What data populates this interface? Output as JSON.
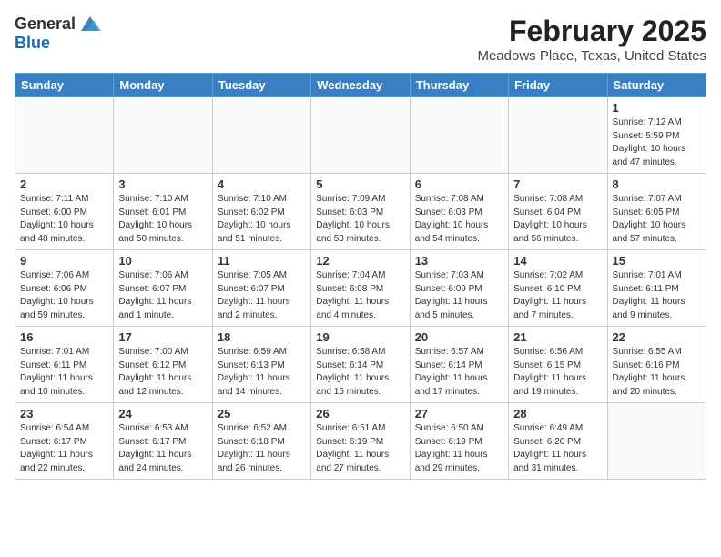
{
  "header": {
    "logo_general": "General",
    "logo_blue": "Blue",
    "month": "February 2025",
    "location": "Meadows Place, Texas, United States"
  },
  "days_of_week": [
    "Sunday",
    "Monday",
    "Tuesday",
    "Wednesday",
    "Thursday",
    "Friday",
    "Saturday"
  ],
  "weeks": [
    [
      {
        "day": "",
        "info": ""
      },
      {
        "day": "",
        "info": ""
      },
      {
        "day": "",
        "info": ""
      },
      {
        "day": "",
        "info": ""
      },
      {
        "day": "",
        "info": ""
      },
      {
        "day": "",
        "info": ""
      },
      {
        "day": "1",
        "info": "Sunrise: 7:12 AM\nSunset: 5:59 PM\nDaylight: 10 hours and 47 minutes."
      }
    ],
    [
      {
        "day": "2",
        "info": "Sunrise: 7:11 AM\nSunset: 6:00 PM\nDaylight: 10 hours and 48 minutes."
      },
      {
        "day": "3",
        "info": "Sunrise: 7:10 AM\nSunset: 6:01 PM\nDaylight: 10 hours and 50 minutes."
      },
      {
        "day": "4",
        "info": "Sunrise: 7:10 AM\nSunset: 6:02 PM\nDaylight: 10 hours and 51 minutes."
      },
      {
        "day": "5",
        "info": "Sunrise: 7:09 AM\nSunset: 6:03 PM\nDaylight: 10 hours and 53 minutes."
      },
      {
        "day": "6",
        "info": "Sunrise: 7:08 AM\nSunset: 6:03 PM\nDaylight: 10 hours and 54 minutes."
      },
      {
        "day": "7",
        "info": "Sunrise: 7:08 AM\nSunset: 6:04 PM\nDaylight: 10 hours and 56 minutes."
      },
      {
        "day": "8",
        "info": "Sunrise: 7:07 AM\nSunset: 6:05 PM\nDaylight: 10 hours and 57 minutes."
      }
    ],
    [
      {
        "day": "9",
        "info": "Sunrise: 7:06 AM\nSunset: 6:06 PM\nDaylight: 10 hours and 59 minutes."
      },
      {
        "day": "10",
        "info": "Sunrise: 7:06 AM\nSunset: 6:07 PM\nDaylight: 11 hours and 1 minute."
      },
      {
        "day": "11",
        "info": "Sunrise: 7:05 AM\nSunset: 6:07 PM\nDaylight: 11 hours and 2 minutes."
      },
      {
        "day": "12",
        "info": "Sunrise: 7:04 AM\nSunset: 6:08 PM\nDaylight: 11 hours and 4 minutes."
      },
      {
        "day": "13",
        "info": "Sunrise: 7:03 AM\nSunset: 6:09 PM\nDaylight: 11 hours and 5 minutes."
      },
      {
        "day": "14",
        "info": "Sunrise: 7:02 AM\nSunset: 6:10 PM\nDaylight: 11 hours and 7 minutes."
      },
      {
        "day": "15",
        "info": "Sunrise: 7:01 AM\nSunset: 6:11 PM\nDaylight: 11 hours and 9 minutes."
      }
    ],
    [
      {
        "day": "16",
        "info": "Sunrise: 7:01 AM\nSunset: 6:11 PM\nDaylight: 11 hours and 10 minutes."
      },
      {
        "day": "17",
        "info": "Sunrise: 7:00 AM\nSunset: 6:12 PM\nDaylight: 11 hours and 12 minutes."
      },
      {
        "day": "18",
        "info": "Sunrise: 6:59 AM\nSunset: 6:13 PM\nDaylight: 11 hours and 14 minutes."
      },
      {
        "day": "19",
        "info": "Sunrise: 6:58 AM\nSunset: 6:14 PM\nDaylight: 11 hours and 15 minutes."
      },
      {
        "day": "20",
        "info": "Sunrise: 6:57 AM\nSunset: 6:14 PM\nDaylight: 11 hours and 17 minutes."
      },
      {
        "day": "21",
        "info": "Sunrise: 6:56 AM\nSunset: 6:15 PM\nDaylight: 11 hours and 19 minutes."
      },
      {
        "day": "22",
        "info": "Sunrise: 6:55 AM\nSunset: 6:16 PM\nDaylight: 11 hours and 20 minutes."
      }
    ],
    [
      {
        "day": "23",
        "info": "Sunrise: 6:54 AM\nSunset: 6:17 PM\nDaylight: 11 hours and 22 minutes."
      },
      {
        "day": "24",
        "info": "Sunrise: 6:53 AM\nSunset: 6:17 PM\nDaylight: 11 hours and 24 minutes."
      },
      {
        "day": "25",
        "info": "Sunrise: 6:52 AM\nSunset: 6:18 PM\nDaylight: 11 hours and 26 minutes."
      },
      {
        "day": "26",
        "info": "Sunrise: 6:51 AM\nSunset: 6:19 PM\nDaylight: 11 hours and 27 minutes."
      },
      {
        "day": "27",
        "info": "Sunrise: 6:50 AM\nSunset: 6:19 PM\nDaylight: 11 hours and 29 minutes."
      },
      {
        "day": "28",
        "info": "Sunrise: 6:49 AM\nSunset: 6:20 PM\nDaylight: 11 hours and 31 minutes."
      },
      {
        "day": "",
        "info": ""
      }
    ]
  ]
}
